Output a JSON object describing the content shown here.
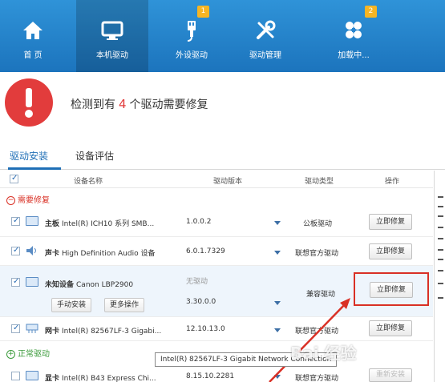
{
  "nav": {
    "items": [
      {
        "label": "首 页",
        "badge": ""
      },
      {
        "label": "本机驱动",
        "badge": ""
      },
      {
        "label": "外设驱动",
        "badge": "1"
      },
      {
        "label": "驱动管理",
        "badge": ""
      },
      {
        "label": "加载中...",
        "badge": "2"
      }
    ]
  },
  "alert": {
    "prefix": "检测到有",
    "count": "4",
    "suffix": "个驱动需要修复"
  },
  "tabs": [
    "驱动安装",
    "设备评估"
  ],
  "table": {
    "headers": [
      "设备名称",
      "驱动版本",
      "驱动类型",
      "操作"
    ],
    "sections": {
      "needs_fix": "需要修复",
      "normal": "正常驱动"
    },
    "rows": [
      {
        "category": "主板",
        "name": "Intel(R) ICH10 系列 SMB...",
        "version": "1.0.0.2",
        "type": "公板驱动",
        "action": "立即修复"
      },
      {
        "category": "声卡",
        "name": "High Definition Audio 设备",
        "version": "6.0.1.7329",
        "type": "联想官方驱动",
        "action": "立即修复"
      },
      {
        "category": "未知设备",
        "name": "Canon LBP2900",
        "version": "无驱动",
        "new_version": "3.30.0.0",
        "type": "兼容驱动",
        "action": "立即修复",
        "btn_manual": "手动安装",
        "btn_more": "更多操作"
      },
      {
        "category": "网卡",
        "name": "Intel(R) 82567LF-3 Gigabi...",
        "version": "12.10.13.0",
        "type": "联想官方驱动",
        "action": "立即修复"
      },
      {
        "category": "显卡",
        "name": "Intel(R) B43 Express Chi...",
        "version": "8.15.10.2281",
        "type": "联想官方驱动",
        "action": "重新安装"
      }
    ]
  },
  "tooltip": "Intel(R) 82567LF-3 Gigabit Network Connection",
  "watermark": "Bai 经验",
  "colors": {
    "nav_bg": "#2a86d0",
    "alert_red": "#e23c3c",
    "accent_blue": "#1f6fb6",
    "annotation_red": "#d93025"
  }
}
